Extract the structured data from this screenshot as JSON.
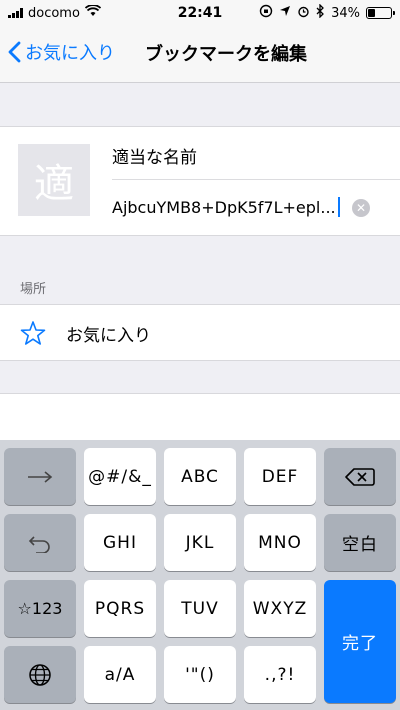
{
  "status_bar": {
    "carrier": "docomo",
    "time": "22:41",
    "battery": "34%",
    "battery_level": 0.34
  },
  "nav": {
    "back_label": "お気に入り",
    "title": "ブックマークを編集"
  },
  "bookmark": {
    "thumb_char": "適",
    "name": "適当な名前",
    "url": "AjbcuYMB8+DpK5f7L+epl..."
  },
  "location": {
    "section_label": "場所",
    "folder": "お気に入り"
  },
  "keyboard": {
    "rows": [
      [
        "→",
        "@#/&_",
        "ABC",
        "DEF",
        "⌫"
      ],
      [
        "↶",
        "GHI",
        "JKL",
        "MNO",
        "空白"
      ],
      [
        "☆123",
        "PQRS",
        "TUV",
        "WXYZ",
        "完了"
      ],
      [
        "🌐",
        "a/A",
        "'\"()",
        ".,?!"
      ]
    ]
  },
  "colors": {
    "accent": "#0a7aff"
  }
}
